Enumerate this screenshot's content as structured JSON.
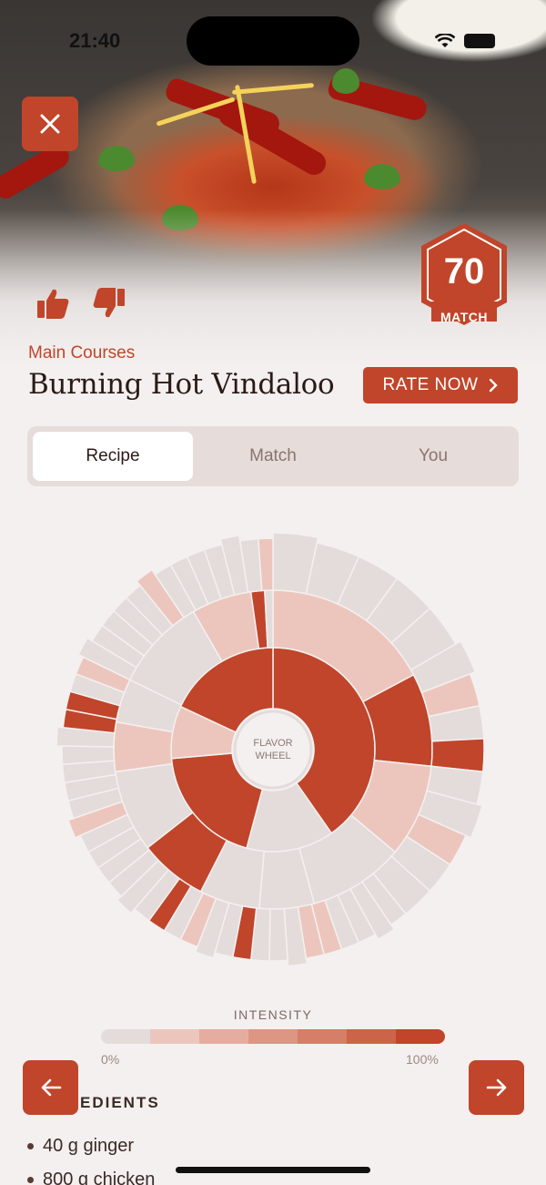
{
  "status_bar": {
    "time": "21:40"
  },
  "header": {
    "category": "Main Courses",
    "title": "Burning Hot Vindaloo",
    "rate_label": "RATE NOW",
    "match": {
      "value": "70",
      "label": "MATCH"
    }
  },
  "tabs": [
    {
      "label": "Recipe",
      "active": true
    },
    {
      "label": "Match",
      "active": false
    },
    {
      "label": "You",
      "active": false
    }
  ],
  "wheel": {
    "center_label_1": "FLAVOR",
    "center_label_2": "WHEEL"
  },
  "intensity": {
    "label": "INTENSITY",
    "min": "0%",
    "max": "100%",
    "colors": [
      "#e3dcdb",
      "#ecc6bd",
      "#e5ad9f",
      "#dc9683",
      "#d67e68",
      "#cc6449",
      "#c0452a"
    ]
  },
  "ingredients": {
    "title_visible": "EDIENTS",
    "items": [
      "40 g ginger",
      "800 g chicken"
    ]
  },
  "colors": {
    "accent": "#c0452a",
    "background": "#f4f0ef",
    "neutral": "#e3e0e0"
  }
}
